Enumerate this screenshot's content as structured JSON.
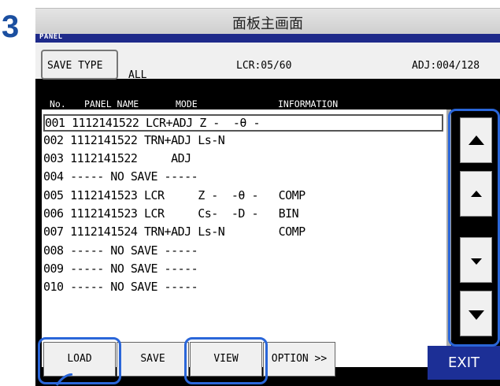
{
  "step_number": "3",
  "caption": "面板主画面",
  "title_bar": "PANEL",
  "save_type": {
    "label": "SAVE TYPE",
    "value": "ALL"
  },
  "lcr_count": "LCR:05/60",
  "adj_count": "ADJ:004/128",
  "columns": {
    "no": "No.",
    "panel_name": "PANEL NAME",
    "mode": "MODE",
    "information": "INFORMATION"
  },
  "rows": [
    {
      "text": "001 1112141522 LCR+ADJ Z -  -θ -",
      "selected": true
    },
    {
      "text": "002 1112141522 TRN+ADJ Ls-N"
    },
    {
      "text": "003 1112141522     ADJ"
    },
    {
      "text": "004 ----- NO SAVE -----"
    },
    {
      "text": "005 1112141523 LCR     Z -  -θ -   COMP"
    },
    {
      "text": "006 1112141523 LCR     Cs-  -D -   BIN"
    },
    {
      "text": "007 1112141524 TRN+ADJ Ls-N        COMP"
    },
    {
      "text": "008 ----- NO SAVE -----"
    },
    {
      "text": "009 ----- NO SAVE -----"
    },
    {
      "text": "010 ----- NO SAVE -----"
    }
  ],
  "buttons": {
    "load": "LOAD",
    "save": "SAVE",
    "view": "VIEW",
    "option": "OPTION >>",
    "exit": "EXIT"
  },
  "nav_icons": [
    "page-up-icon",
    "line-up-icon",
    "line-down-icon",
    "page-down-icon"
  ]
}
